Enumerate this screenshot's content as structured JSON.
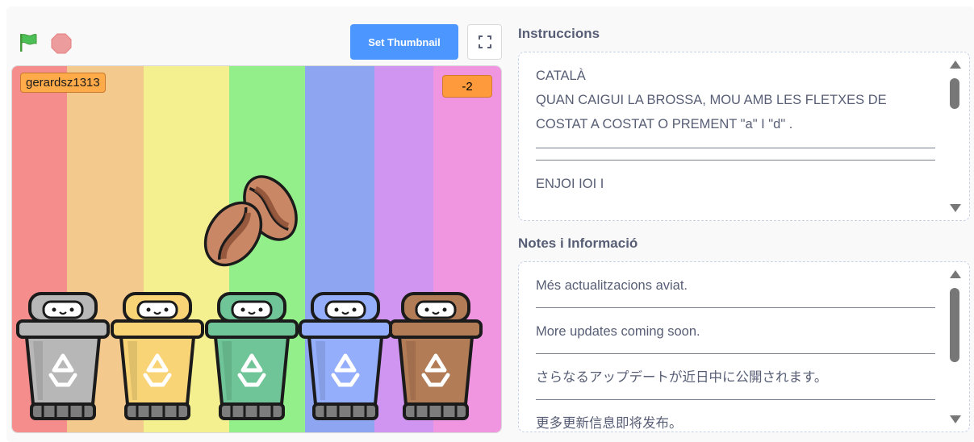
{
  "toolbar": {
    "green_flag": "green-flag-icon",
    "stop": "stop-icon",
    "set_thumbnail_label": "Set Thumbnail",
    "fullscreen": "fullscreen-icon"
  },
  "stage": {
    "stripe_colors": [
      "#f58d8d",
      "#f3c98e",
      "#f4f08f",
      "#92ef8a",
      "#8ea6f2",
      "#cf95f1",
      "#f095e0"
    ],
    "username_monitor": "gerardsz1313",
    "score_monitor": "-2",
    "bin_colors": [
      "#b7b7b7",
      "#f9d477",
      "#6fc597",
      "#94aefb",
      "#b27c56"
    ]
  },
  "instructions": {
    "heading": "Instruccions",
    "line1": "CATALÀ",
    "line2": "QUAN CAIGUI LA BROSSA, MOU AMB LES FLETXES DE COSTAT A COSTAT O PREMENT \"a\" I \"d\" .",
    "line3": "ENJOI IOI I"
  },
  "notes": {
    "heading": "Notes i Informació",
    "line1": "Més actualitzacions aviat.",
    "line2": "More updates coming soon.",
    "line3": "さらなるアップデートが近日中に公開されます。",
    "line4": "更多更新信息即将发布。"
  }
}
